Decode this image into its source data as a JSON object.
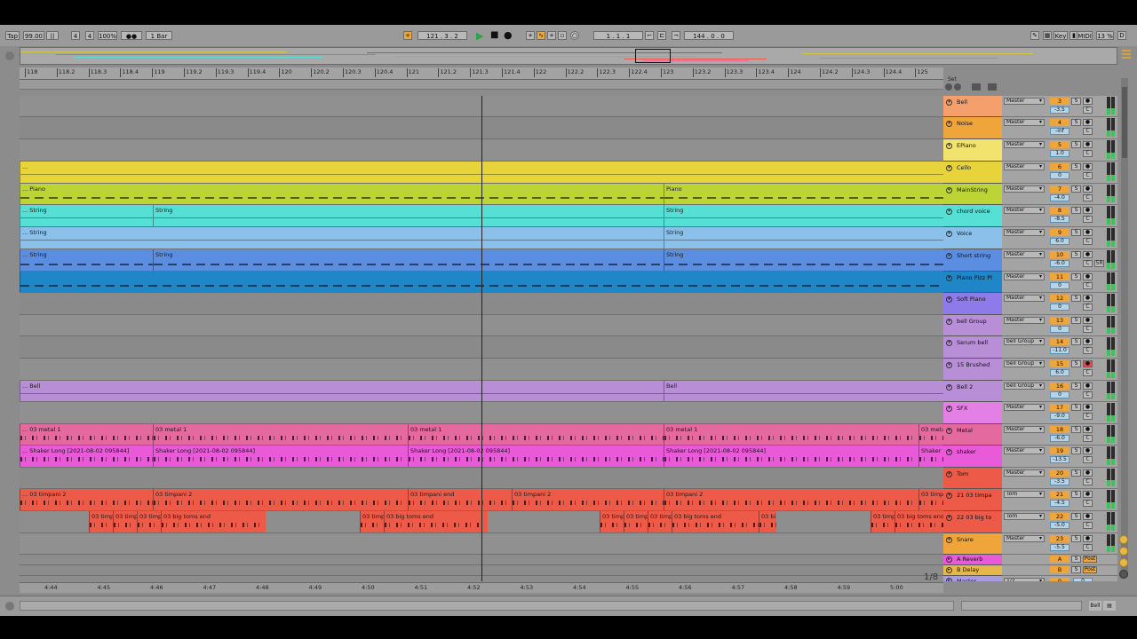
{
  "control_bar": {
    "tap": "Tap",
    "tempo": "99.00",
    "sig_num": "4",
    "sig_slash": "/",
    "sig_den": "4",
    "zoom": "100%",
    "metro": "●●",
    "quant": "1 Bar",
    "pos_bar": "121",
    "pos_beat": "3",
    "pos_sixteenth": "2",
    "play_icon": "▶",
    "stop_icon": "■",
    "rec_icon": "●",
    "loop_start": "1 .   1 .   1",
    "loop_len": "144 .   0 .   0",
    "key": "Key",
    "midi": "MIDI",
    "cpu": "13 %"
  },
  "ruler": [
    "118",
    "118.2",
    "118.3",
    "118.4",
    "119",
    "119.2",
    "119.3",
    "119.4",
    "120",
    "120.2",
    "120.3",
    "120.4",
    "121",
    "121.2",
    "121.3",
    "121.4",
    "122",
    "122.2",
    "122.3",
    "122.4",
    "123",
    "123.2",
    "123.3",
    "123.4",
    "124",
    "124.2",
    "124.3",
    "124.4",
    "125"
  ],
  "time_ruler": [
    "4:44",
    "4:45",
    "4:46",
    "4:47",
    "4:48",
    "4:49",
    "4:50",
    "4:51",
    "4:52",
    "4:53",
    "4:54",
    "4:55",
    "4:56",
    "4:57",
    "4:58",
    "4:59",
    "5:00"
  ],
  "zoom_ratio": "1/8",
  "set_label": "Set",
  "bottom_right": "Bell",
  "tracks": [
    {
      "name": "Bell",
      "color": "#f5a06c",
      "route": "Master",
      "num": "3",
      "vol": "-3.5"
    },
    {
      "name": "Noise",
      "color": "#f0a53a",
      "route": "Master",
      "num": "4",
      "vol": "-inf"
    },
    {
      "name": "EPiano",
      "color": "#f2e26e",
      "route": "Master",
      "num": "5",
      "vol": "1.0"
    },
    {
      "name": "Cello",
      "color": "#e6d43a",
      "route": "Master",
      "num": "6",
      "vol": "0"
    },
    {
      "name": "MainString",
      "color": "#bcd534",
      "route": "Master",
      "num": "7",
      "vol": "-4.0"
    },
    {
      "name": "chord voice",
      "color": "#56dfd4",
      "route": "Master",
      "num": "8",
      "vol": "-8.5"
    },
    {
      "name": "Voice",
      "color": "#8ac0ea",
      "route": "Master",
      "num": "9",
      "vol": "6.0"
    },
    {
      "name": "Short string",
      "color": "#5b8de0",
      "route": "Master",
      "num": "10",
      "vol": "-6.0",
      "extra": "5R"
    },
    {
      "name": "Piano Pizz Pl",
      "color": "#1f86c7",
      "route": "Master",
      "num": "11",
      "vol": "0"
    },
    {
      "name": "Soft Piano",
      "color": "#8e7ae8",
      "route": "Master",
      "num": "12",
      "vol": "0"
    },
    {
      "name": "bell Group",
      "color": "#b88fd6",
      "route": "Master",
      "num": "13",
      "vol": "0"
    },
    {
      "name": "Serum bell",
      "color": "#b88fd6",
      "route": "bell Group",
      "num": "14",
      "vol": "-11.0"
    },
    {
      "name": "15 Brushed",
      "color": "#b88fd6",
      "route": "bell Group",
      "num": "15",
      "vol": "6.0"
    },
    {
      "name": "Bell 2",
      "color": "#b88fd6",
      "route": "bell Group",
      "num": "16",
      "vol": "0"
    },
    {
      "name": "SFX",
      "color": "#e47fe6",
      "route": "Master",
      "num": "17",
      "vol": "-9.0"
    },
    {
      "name": "Metal",
      "color": "#e3699e",
      "route": "Master",
      "num": "18",
      "vol": "-6.0"
    },
    {
      "name": "shaker",
      "color": "#e85ad7",
      "route": "Master",
      "num": "19",
      "vol": "-13.5"
    },
    {
      "name": "Tom",
      "color": "#ed5a48",
      "route": "Master",
      "num": "20",
      "vol": "-3.5"
    },
    {
      "name": "21 03 timpa",
      "color": "#ed5a48",
      "route": "Tom",
      "num": "21",
      "vol": "-4.5"
    },
    {
      "name": "22 03 big to",
      "color": "#ed5a48",
      "route": "Tom",
      "num": "22",
      "vol": "-5.0"
    },
    {
      "name": "Snare",
      "color": "#f0a53a",
      "route": "Master",
      "num": "23",
      "vol": "-5.5"
    }
  ],
  "returns": [
    {
      "name": "A Reverb",
      "color": "#e85ad7",
      "num": "A",
      "post": "Post"
    },
    {
      "name": "B Delay",
      "color": "#e6b84a",
      "num": "B",
      "post": "Post"
    }
  ],
  "master": {
    "name": "Master",
    "route": "1/2",
    "num": "0",
    "vol": "0"
  },
  "clips": {
    "cello": "...",
    "piano1": "... Piano",
    "piano2": "Piano",
    "cv1": "... String",
    "cv2": "String",
    "cv3": "String",
    "voice1": "... String",
    "voice2": "String",
    "ss1": "... String",
    "ss2": "String",
    "ss3": "String",
    "bell1": "... Bell",
    "bell2": "Bell",
    "metal1": "... 03 metal 1",
    "metal2": "03 metal 1",
    "metal3": "03 metal 1",
    "metal4": "03 metal 1",
    "metal5": "03 meta",
    "shaker1": "... Shaker Long [2021-08-02 095844]",
    "shaker2": "Shaker Long [2021-08-02 095844]",
    "shaker3": "Shaker Long [2021-08-02 095844]",
    "shaker4": "Shaker Long [2021-08-02 095844]",
    "shaker5": "Shaker",
    "timp1": "... 03 timpani 2",
    "timp2": "03 timpani 2",
    "timp3": "03 timpani end",
    "timp4": "03 timpani 2",
    "timp5": "03 timpani 2",
    "timp6": "03 timp",
    "big_short": "03 timp",
    "big_end": "03 big toms end",
    "big_bi": "03 bi"
  }
}
